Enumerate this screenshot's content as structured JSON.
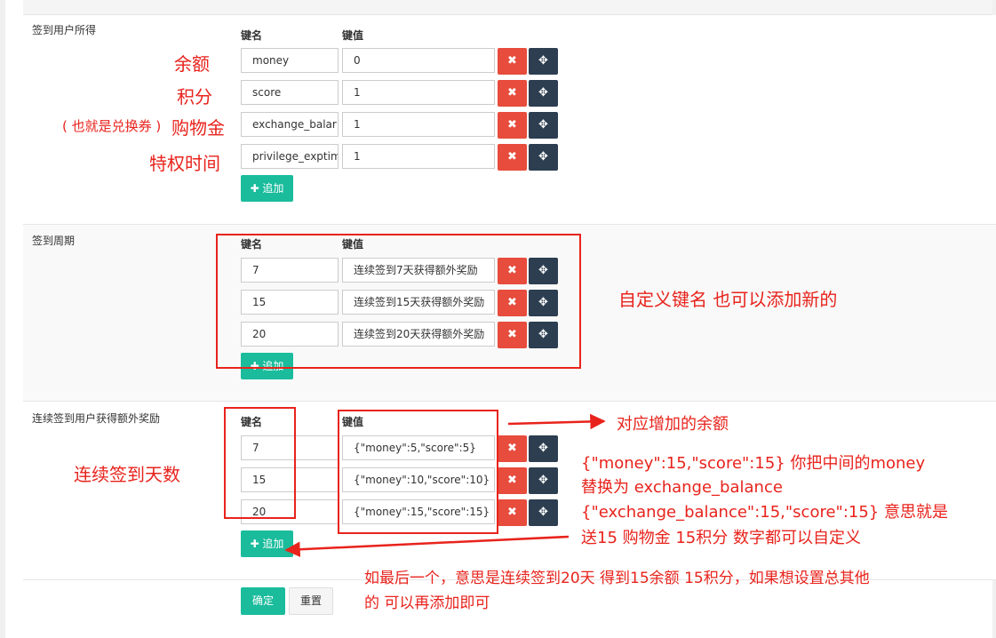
{
  "form": {
    "section_reward": {
      "label": "签到用户所得",
      "key_header": "键名",
      "value_header": "键值",
      "rows": [
        {
          "key": "money",
          "value": "0"
        },
        {
          "key": "score",
          "value": "1"
        },
        {
          "key": "exchange_balar",
          "value": "1"
        },
        {
          "key": "privilege_exptim",
          "value": "1"
        }
      ],
      "add_label": "✚ 追加"
    },
    "section_cycle": {
      "label": "签到周期",
      "key_header": "键名",
      "value_header": "键值",
      "rows": [
        {
          "key": "7",
          "value": "连续签到7天获得额外奖励"
        },
        {
          "key": "15",
          "value": "连续签到15天获得额外奖励"
        },
        {
          "key": "20",
          "value": "连续签到20天获得额外奖励"
        }
      ],
      "add_label": "✚ 追加"
    },
    "section_extra": {
      "label": "连续签到用户获得额外奖励",
      "key_header": "键名",
      "value_header": "键值",
      "rows": [
        {
          "key": "7",
          "value": "{\"money\":5,\"score\":5}"
        },
        {
          "key": "15",
          "value": "{\"money\":10,\"score\":10}"
        },
        {
          "key": "20",
          "value": "{\"money\":15,\"score\":15}"
        }
      ],
      "add_label": "✚ 追加"
    },
    "submit_label": "确定",
    "reset_label": "重置",
    "delete_glyph": "✖",
    "move_glyph": "✥"
  },
  "annotations": {
    "balance": "余额",
    "score": "积分",
    "shopping_prefix": "( 也就是兑换券 )",
    "shopping": "购物金",
    "privilege": "特权时间",
    "custom_key": "自定义键名  也可以添加新的",
    "consecutive_days": "连续签到天数",
    "added_balance": "对应增加的余额",
    "explain_1": "{\"money\":15,\"score\":15}     你把中间的money",
    "explain_2": "替换为  exchange_balance",
    "explain_3": "{\"exchange_balance\":15,\"score\":15}  意思就是",
    "explain_4": "送15 购物金  15积分  数字都可以自定义",
    "bottom_1": "如最后一个，意思是连续签到20天  得到15余额   15积分，如果想设置总其他",
    "bottom_2": "的 可以再添加即可"
  },
  "colors": {
    "annotation_red": "#e8231c",
    "delete_red": "#e74c3c",
    "move_dark": "#2c3e50",
    "add_teal": "#1abc9c"
  }
}
